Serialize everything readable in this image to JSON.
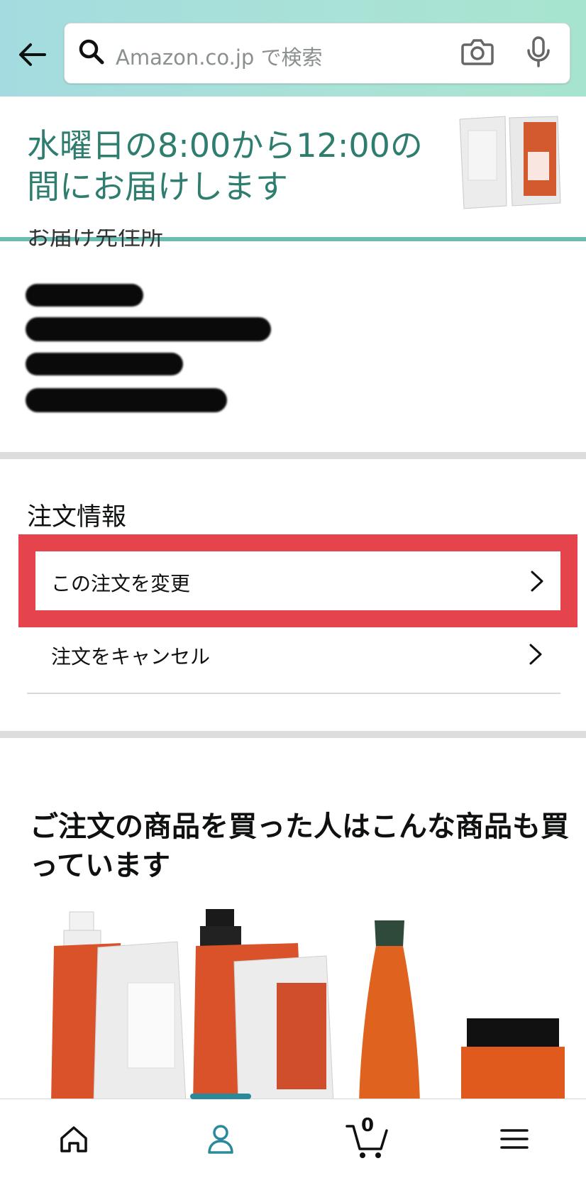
{
  "search": {
    "placeholder": "Amazon.co.jp で検索"
  },
  "delivery": {
    "message": "水曜日の8:00から12:00の間にお届けします"
  },
  "address": {
    "label": "お届け先住所"
  },
  "order_info": {
    "title": "注文情報",
    "change_label": "この注文を変更",
    "cancel_label": "注文をキャンセル"
  },
  "recommendations": {
    "title": "ご注文の商品を買った人はこんな商品も買っています"
  },
  "tabbar": {
    "items": [
      "home-icon",
      "account-icon",
      "cart-icon",
      "menu-icon"
    ],
    "cart_count": "0"
  },
  "colors": {
    "header_gradient_start": "#a4dbe0",
    "header_gradient_end": "#a7e4cf",
    "delivery_text": "#2f7d6f",
    "highlight": "#e5444c",
    "active_tab": "#2a8a9a"
  }
}
